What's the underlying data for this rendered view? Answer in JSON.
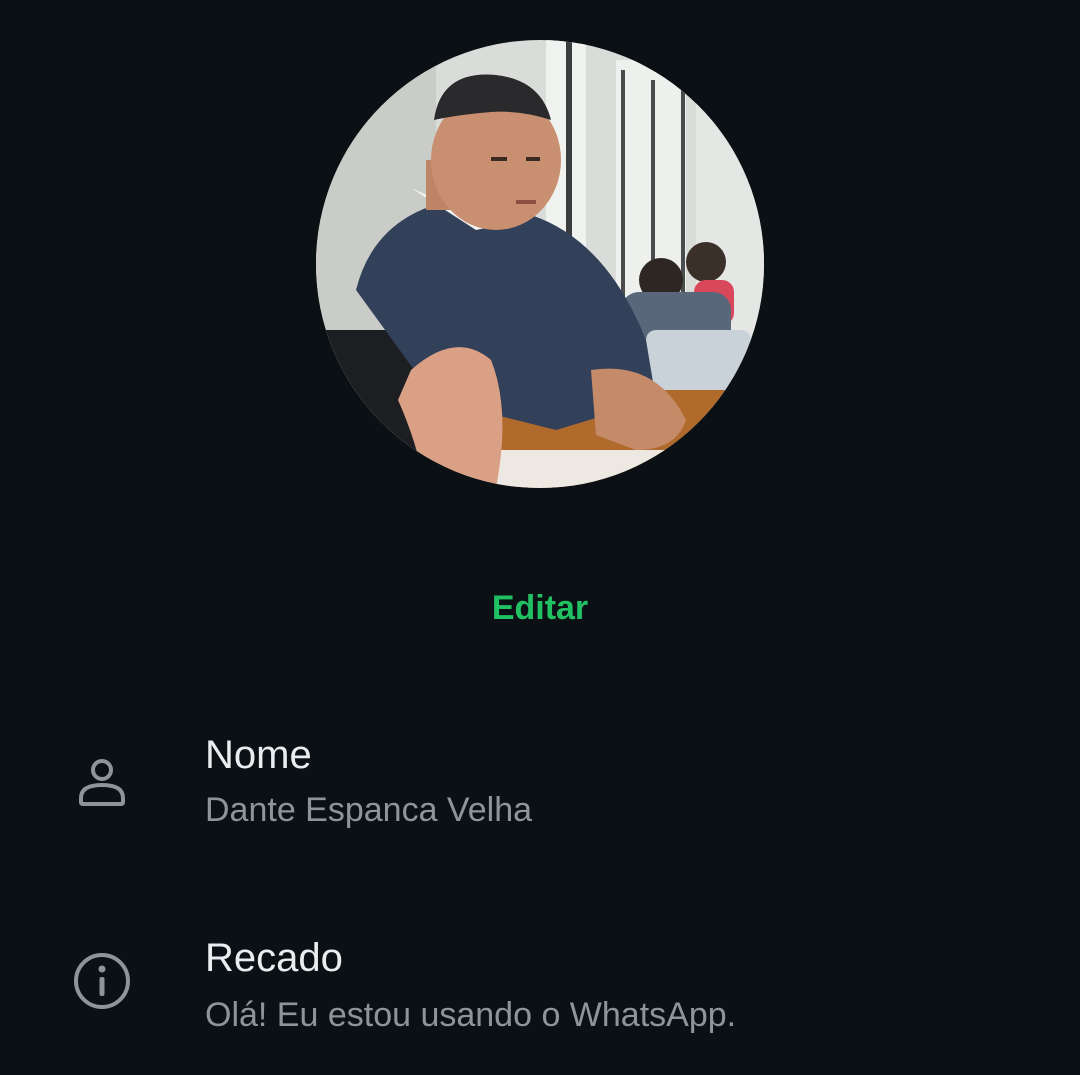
{
  "colors": {
    "background": "#0b1014",
    "accent": "#21c063",
    "title_text": "#e9edef",
    "secondary_text": "#8e9599",
    "icon": "#8e9599"
  },
  "profile": {
    "photo_icon": "profile-photo",
    "edit_label": "Editar"
  },
  "fields": {
    "name": {
      "icon": "person-icon",
      "label": "Nome",
      "value": "Dante Espanca Velha"
    },
    "about": {
      "icon": "info-icon",
      "label": "Recado",
      "value": "Olá! Eu estou usando o WhatsApp."
    }
  }
}
